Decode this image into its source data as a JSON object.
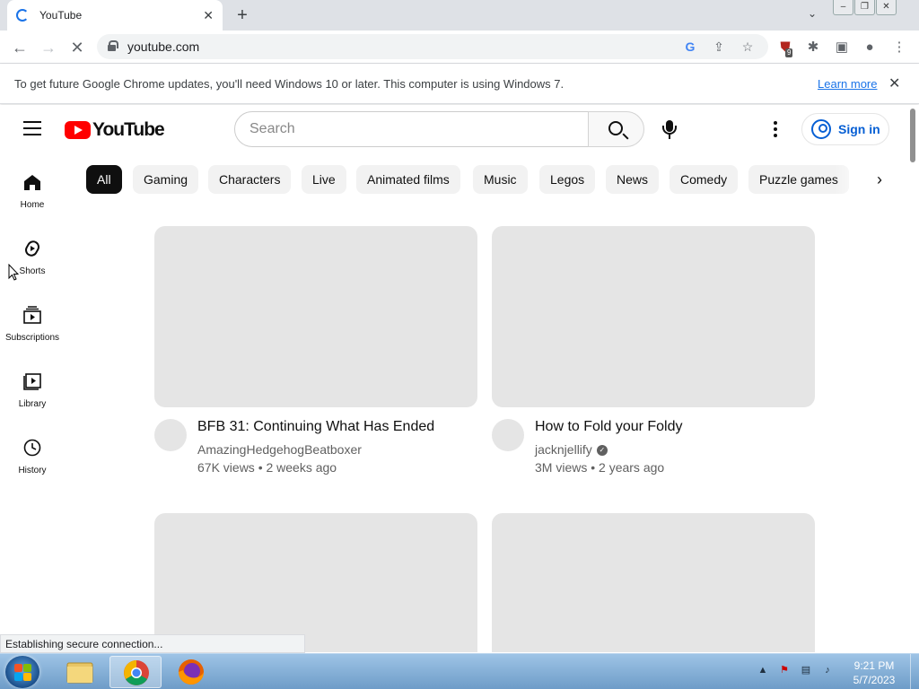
{
  "browser": {
    "tab_title": "YouTube",
    "url": "youtube.com",
    "extension_badge": "9",
    "infobar_text": "To get future Google Chrome updates, you'll need Windows 10 or later. This computer is using Windows 7.",
    "infobar_link": "Learn more",
    "status_text": "Establishing secure connection..."
  },
  "youtube": {
    "logo_text": "YouTube",
    "search_placeholder": "Search",
    "sign_in": "Sign in",
    "sidebar": [
      {
        "label": "Home",
        "icon": "home-icon"
      },
      {
        "label": "Shorts",
        "icon": "shorts-icon"
      },
      {
        "label": "Subscriptions",
        "icon": "subscriptions-icon"
      },
      {
        "label": "Library",
        "icon": "library-icon"
      },
      {
        "label": "History",
        "icon": "history-icon"
      }
    ],
    "chips": [
      "All",
      "Gaming",
      "Characters",
      "Live",
      "Animated films",
      "Music",
      "Legos",
      "News",
      "Comedy",
      "Puzzle games"
    ],
    "videos": [
      {
        "title": "BFB 31: Continuing What Has Ended",
        "channel": "AmazingHedgehogBeatboxer",
        "verified": false,
        "meta": "67K views • 2 weeks ago"
      },
      {
        "title": "How to Fold your Foldy",
        "channel": "jacknjellify",
        "verified": true,
        "meta": "3M views • 2 years ago"
      }
    ]
  },
  "taskbar": {
    "time": "9:21 PM",
    "date": "5/7/2023"
  },
  "colors": {
    "youtube_red": "#ff0000",
    "link_blue": "#065fd4",
    "chrome_blue": "#1a73e8"
  }
}
